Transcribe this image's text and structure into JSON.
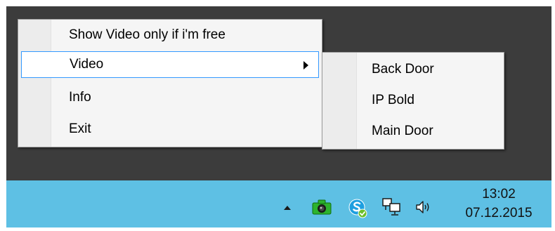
{
  "context_menu": {
    "items": [
      {
        "label": "Show Video only if i'm free"
      },
      {
        "label": "Video"
      },
      {
        "label": "Info"
      },
      {
        "label": "Exit"
      }
    ]
  },
  "submenu": {
    "items": [
      {
        "label": "Back Door"
      },
      {
        "label": "IP Bold"
      },
      {
        "label": "Main Door"
      }
    ]
  },
  "tray": {
    "icons": [
      "show-hidden-icons-arrow",
      "camera-icon",
      "skype-icon",
      "network-icon",
      "speaker-icon"
    ],
    "time": "13:02",
    "date": "07.12.2015"
  },
  "colors": {
    "desktop": "#3c3c3c",
    "taskbar": "#5ec0e4",
    "menu_background": "#f5f5f5",
    "selection_border": "#3399ff"
  }
}
